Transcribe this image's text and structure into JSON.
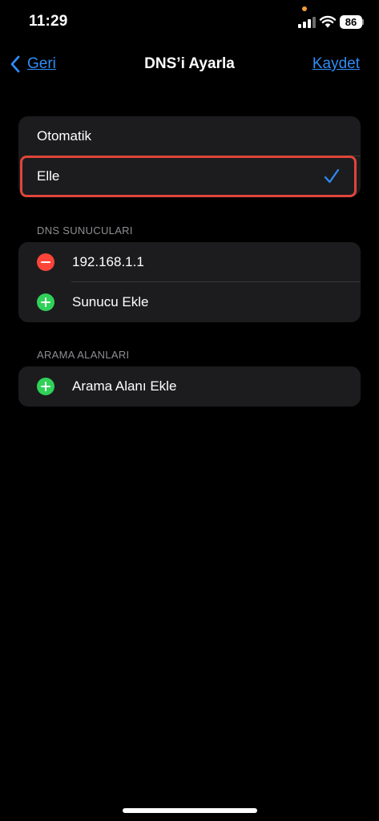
{
  "status_bar": {
    "time": "11:29",
    "battery": "86",
    "privacy_indicator_color": "#f29a38"
  },
  "nav": {
    "back_label": "Geri",
    "title": "DNS’i Ayarla",
    "save_label": "Kaydet"
  },
  "mode_options": [
    {
      "label": "Otomatik",
      "selected": false
    },
    {
      "label": "Elle",
      "selected": true
    }
  ],
  "dns_servers": {
    "header": "DNS SUNUCULARI",
    "items": [
      {
        "label": "192.168.1.1",
        "icon": "remove-icon"
      }
    ],
    "add_label": "Sunucu Ekle"
  },
  "search_domains": {
    "header": "ARAMA ALANLARI",
    "add_label": "Arama Alanı Ekle"
  },
  "colors": {
    "accent": "#2f8cf7",
    "remove": "#ff453a",
    "add": "#30d158",
    "highlight": "#e0453a"
  }
}
